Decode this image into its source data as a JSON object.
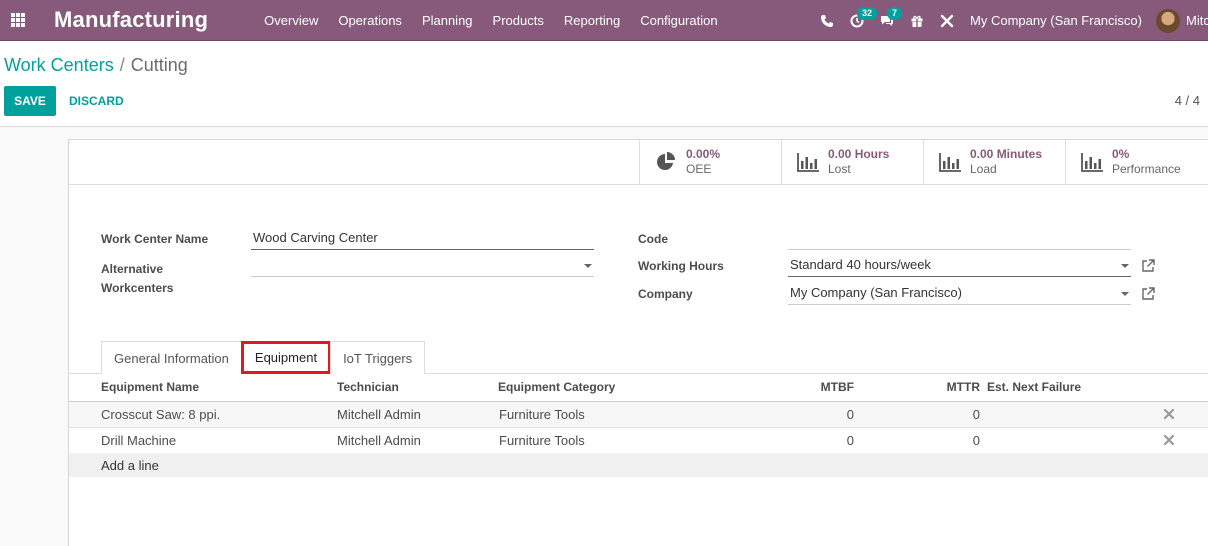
{
  "navbar": {
    "brand": "Manufacturing",
    "menu": [
      "Overview",
      "Operations",
      "Planning",
      "Products",
      "Reporting",
      "Configuration"
    ],
    "activity_count": "32",
    "message_count": "7",
    "company": "My Company (San Francisco)",
    "user_name": "Mitchell Admin"
  },
  "breadcrumb": {
    "parent": "Work Centers",
    "separator": "/",
    "current": "Cutting"
  },
  "buttons": {
    "save": "SAVE",
    "discard": "DISCARD"
  },
  "pager": "4 / 4",
  "stat_buttons": [
    {
      "value": "0.00%",
      "label": "OEE",
      "icon": "pie-chart-icon"
    },
    {
      "value": "0.00 Hours",
      "label": "Lost",
      "icon": "bar-chart-icon"
    },
    {
      "value": "0.00 Minutes",
      "label": "Load",
      "icon": "bar-chart-icon"
    },
    {
      "value": "0%",
      "label": "Performance",
      "icon": "bar-chart-icon"
    }
  ],
  "form": {
    "name_label": "Work Center Name",
    "name_value": "Wood Carving Center",
    "alt_label": "Alternative Workcenters",
    "alt_value": "",
    "code_label": "Code",
    "code_value": "",
    "hours_label": "Working Hours",
    "hours_value": "Standard 40 hours/week",
    "company_label": "Company",
    "company_value": "My Company (San Francisco)"
  },
  "tabs": [
    "General Information",
    "Equipment",
    "IoT Triggers"
  ],
  "active_tab": "Equipment",
  "table": {
    "headers": [
      "Equipment Name",
      "Technician",
      "Equipment Category",
      "MTBF",
      "MTTR",
      "Est. Next Failure"
    ],
    "rows": [
      {
        "name": "Crosscut Saw: 8 ppi.",
        "technician": "Mitchell Admin",
        "category": "Furniture Tools",
        "mtbf": "0",
        "mttr": "0",
        "next_failure": ""
      },
      {
        "name": "Drill Machine",
        "technician": "Mitchell Admin",
        "category": "Furniture Tools",
        "mtbf": "0",
        "mttr": "0",
        "next_failure": ""
      }
    ],
    "add_line": "Add a line"
  },
  "colors": {
    "navbar": "#875a7b",
    "accent": "#00a09d",
    "highlight": "#e0191e"
  }
}
